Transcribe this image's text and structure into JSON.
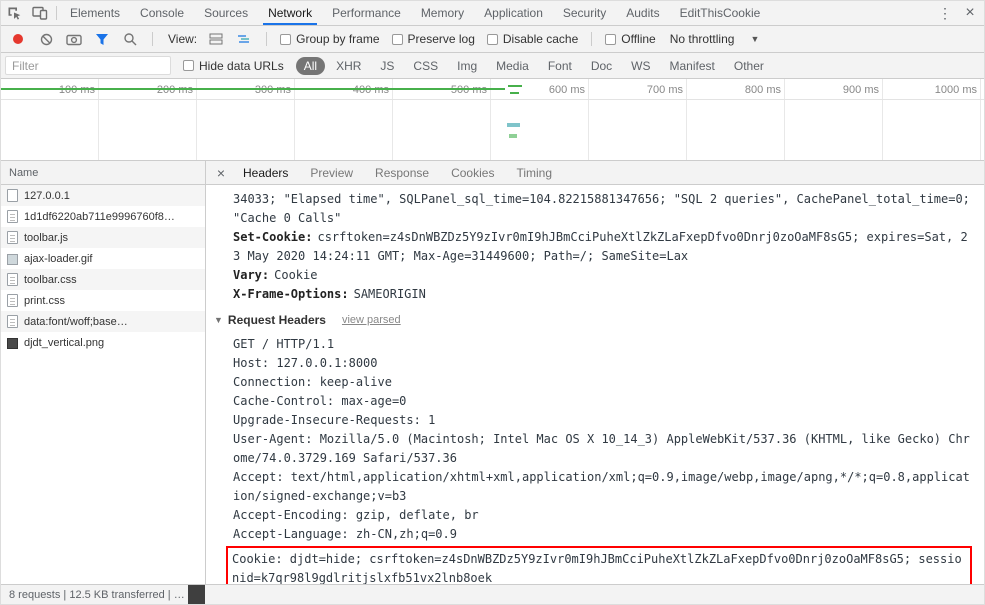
{
  "icons": {
    "menu": "⋮",
    "close": "×",
    "details_close": "×",
    "disclosure": "▼",
    "dropdown_arrow": "▼"
  },
  "colors": {
    "accent_blue": "#1a73e8",
    "record_red": "#e5382e",
    "highlight_red": "#ff0000",
    "overview_green": "#47b04b"
  },
  "tabbar": {
    "tabs": [
      {
        "label": "Elements"
      },
      {
        "label": "Console"
      },
      {
        "label": "Sources"
      },
      {
        "label": "Network",
        "active": true
      },
      {
        "label": "Performance"
      },
      {
        "label": "Memory"
      },
      {
        "label": "Application"
      },
      {
        "label": "Security"
      },
      {
        "label": "Audits"
      },
      {
        "label": "EditThisCookie"
      }
    ]
  },
  "toolbar": {
    "view_label": "View:",
    "checkboxes": [
      {
        "label": "Group by frame"
      },
      {
        "label": "Preserve log"
      },
      {
        "label": "Disable cache"
      }
    ],
    "offline_label": "Offline",
    "throttling_value": "No throttling"
  },
  "filterbar": {
    "filter_placeholder": "Filter",
    "hide_data_urls_label": "Hide data URLs",
    "pills": [
      {
        "label": "All",
        "active": true
      },
      {
        "label": "XHR"
      },
      {
        "label": "JS"
      },
      {
        "label": "CSS"
      },
      {
        "label": "Img"
      },
      {
        "label": "Media"
      },
      {
        "label": "Font"
      },
      {
        "label": "Doc"
      },
      {
        "label": "WS"
      },
      {
        "label": "Manifest"
      },
      {
        "label": "Other"
      }
    ]
  },
  "overview": {
    "ticks": [
      "100 ms",
      "200 ms",
      "300 ms",
      "400 ms",
      "500 ms",
      "600 ms",
      "700 ms",
      "800 ms",
      "900 ms",
      "1000 ms"
    ]
  },
  "requests": {
    "column_header": "Name",
    "items": [
      {
        "name": "127.0.0.1",
        "icon": "document-icon"
      },
      {
        "name": "1d1df6220ab711e9996760f8…",
        "icon": "script-icon"
      },
      {
        "name": "toolbar.js",
        "icon": "script-icon"
      },
      {
        "name": "ajax-loader.gif",
        "icon": "image-icon"
      },
      {
        "name": "toolbar.css",
        "icon": "stylesheet-icon"
      },
      {
        "name": "print.css",
        "icon": "stylesheet-icon"
      },
      {
        "name": "data:font/woff;base…",
        "icon": "font-icon"
      },
      {
        "name": "djdt_vertical.png",
        "icon": "image-dark-icon"
      }
    ]
  },
  "details": {
    "tabs": [
      {
        "label": "Headers",
        "active": true
      },
      {
        "label": "Preview"
      },
      {
        "label": "Response"
      },
      {
        "label": "Cookies"
      },
      {
        "label": "Timing"
      }
    ],
    "response_headers_tail": [
      {
        "name": "",
        "value": "34033; \"Elapsed time\", SQLPanel_sql_time=104.82215881347656; \"SQL 2 queries\", CachePanel_total_time=0; \"Cache 0 Calls\""
      },
      {
        "name": "Set-Cookie:",
        "value": "csrftoken=z4sDnWBZDz5Y9zIvr0mI9hJBmCciPuheXtlZkZLaFxepDfvo0Dnrj0zoOaMF8sG5; expires=Sat, 23 May 2020 14:24:11 GMT; Max-Age=31449600; Path=/; SameSite=Lax"
      },
      {
        "name": "Vary:",
        "value": "Cookie"
      },
      {
        "name": "X-Frame-Options:",
        "value": "SAMEORIGIN"
      }
    ],
    "request_headers_section": {
      "title": "Request Headers",
      "toggle_label": "view parsed"
    },
    "request_headers_raw": [
      {
        "text": "GET / HTTP/1.1"
      },
      {
        "text": "Host: 127.0.0.1:8000"
      },
      {
        "text": "Connection: keep-alive"
      },
      {
        "text": "Cache-Control: max-age=0"
      },
      {
        "text": "Upgrade-Insecure-Requests: 1"
      },
      {
        "text": "User-Agent: Mozilla/5.0 (Macintosh; Intel Mac OS X 10_14_3) AppleWebKit/537.36 (KHTML, like Gecko) Chrome/74.0.3729.169 Safari/537.36"
      },
      {
        "text": "Accept: text/html,application/xhtml+xml,application/xml;q=0.9,image/webp,image/apng,*/*;q=0.8,application/signed-exchange;v=b3"
      },
      {
        "text": "Accept-Encoding: gzip, deflate, br"
      },
      {
        "text": "Accept-Language: zh-CN,zh;q=0.9"
      },
      {
        "text": "Cookie: djdt=hide; csrftoken=z4sDnWBZDz5Y9zIvr0mI9hJBmCciPuheXtlZkZLaFxepDfvo0Dnrj0zoOaMF8sG5; sessionid=k7qr98l9gdlritjslxfb51vx2lnb8oek",
        "highlight": true
      }
    ]
  },
  "statusbar": {
    "summary": "8 requests | 12.5 KB transferred | …"
  }
}
